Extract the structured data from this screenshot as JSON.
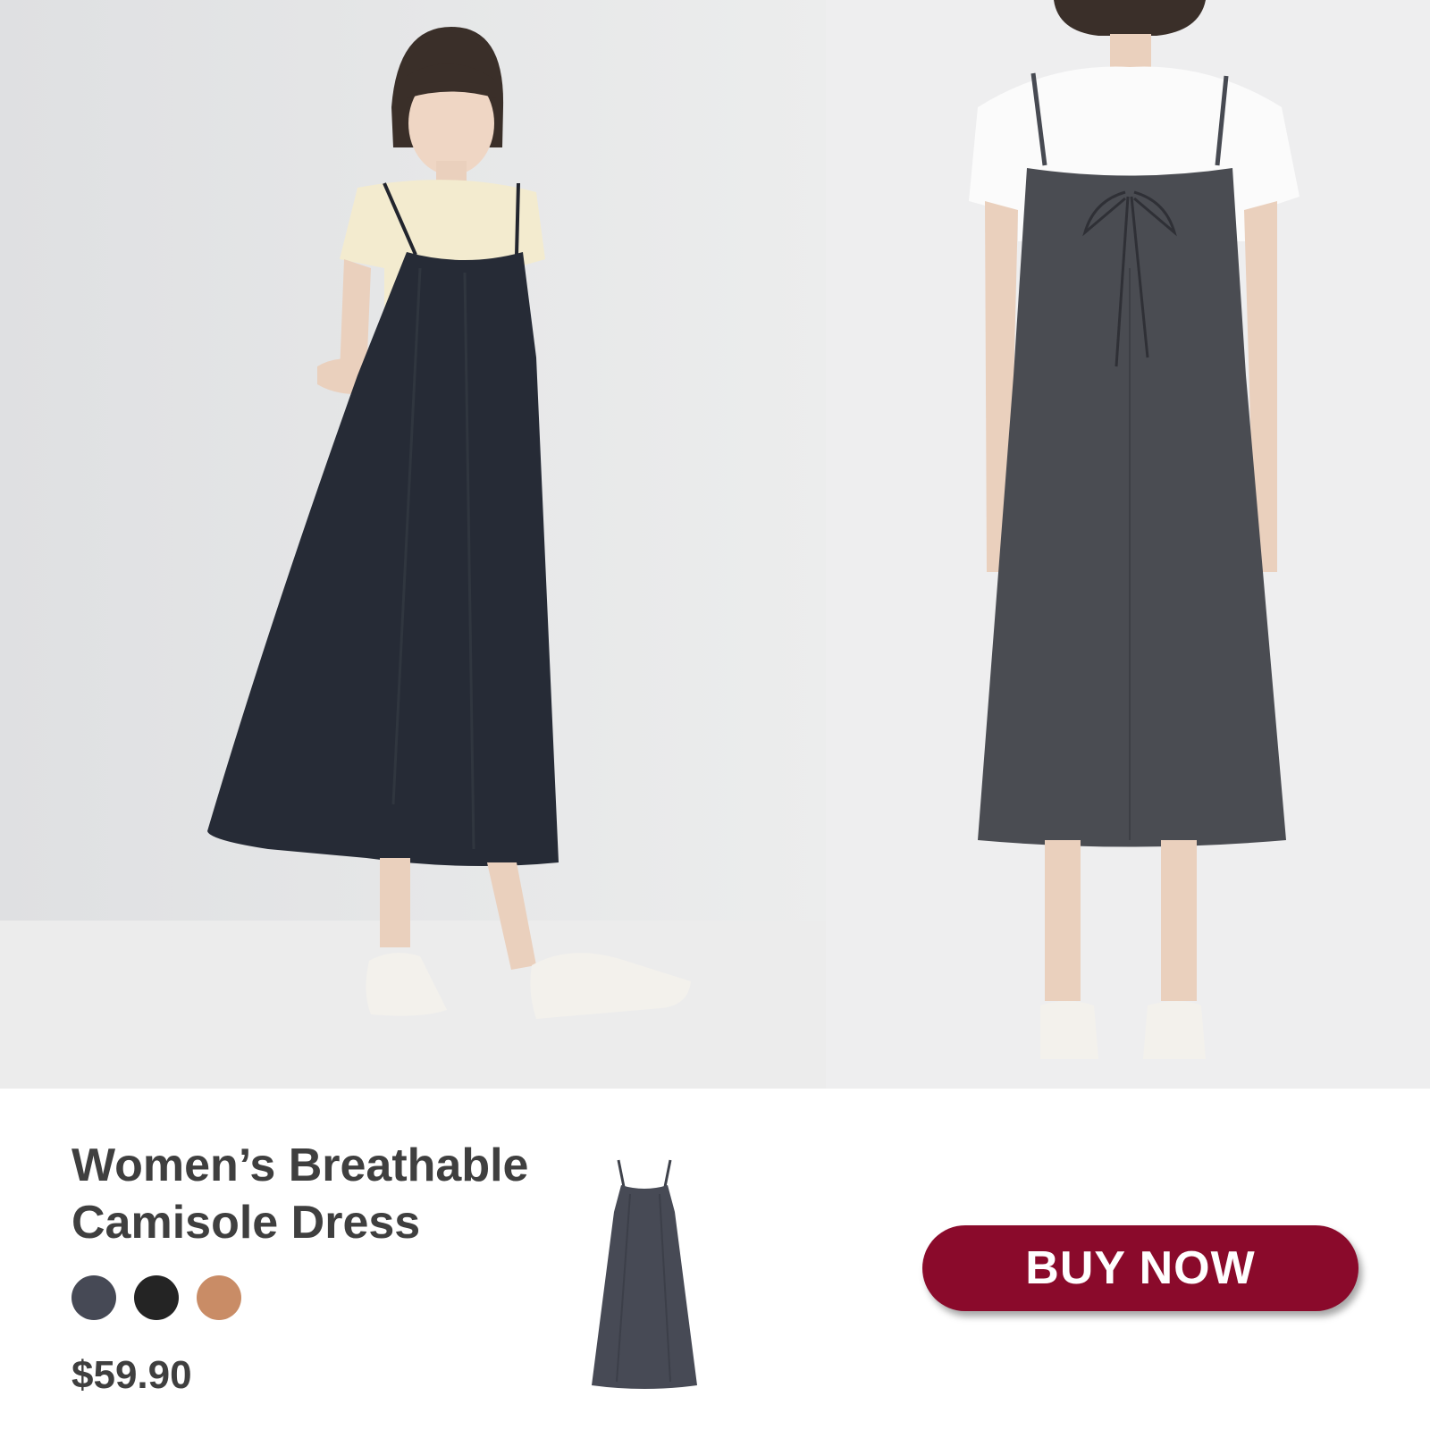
{
  "product": {
    "title_line1": "Women’s Breathable",
    "title_line2": "Camisole Dress",
    "price": "$59.90"
  },
  "swatches": [
    {
      "name": "navy-grey",
      "color": "#464955"
    },
    {
      "name": "black",
      "color": "#242424"
    },
    {
      "name": "tan",
      "color": "#c98c66"
    }
  ],
  "cta": {
    "label": "BUY NOW",
    "color": "#8a0a2b"
  },
  "theme": {
    "text_color": "#3f3f3f",
    "background": "#ffffff"
  }
}
